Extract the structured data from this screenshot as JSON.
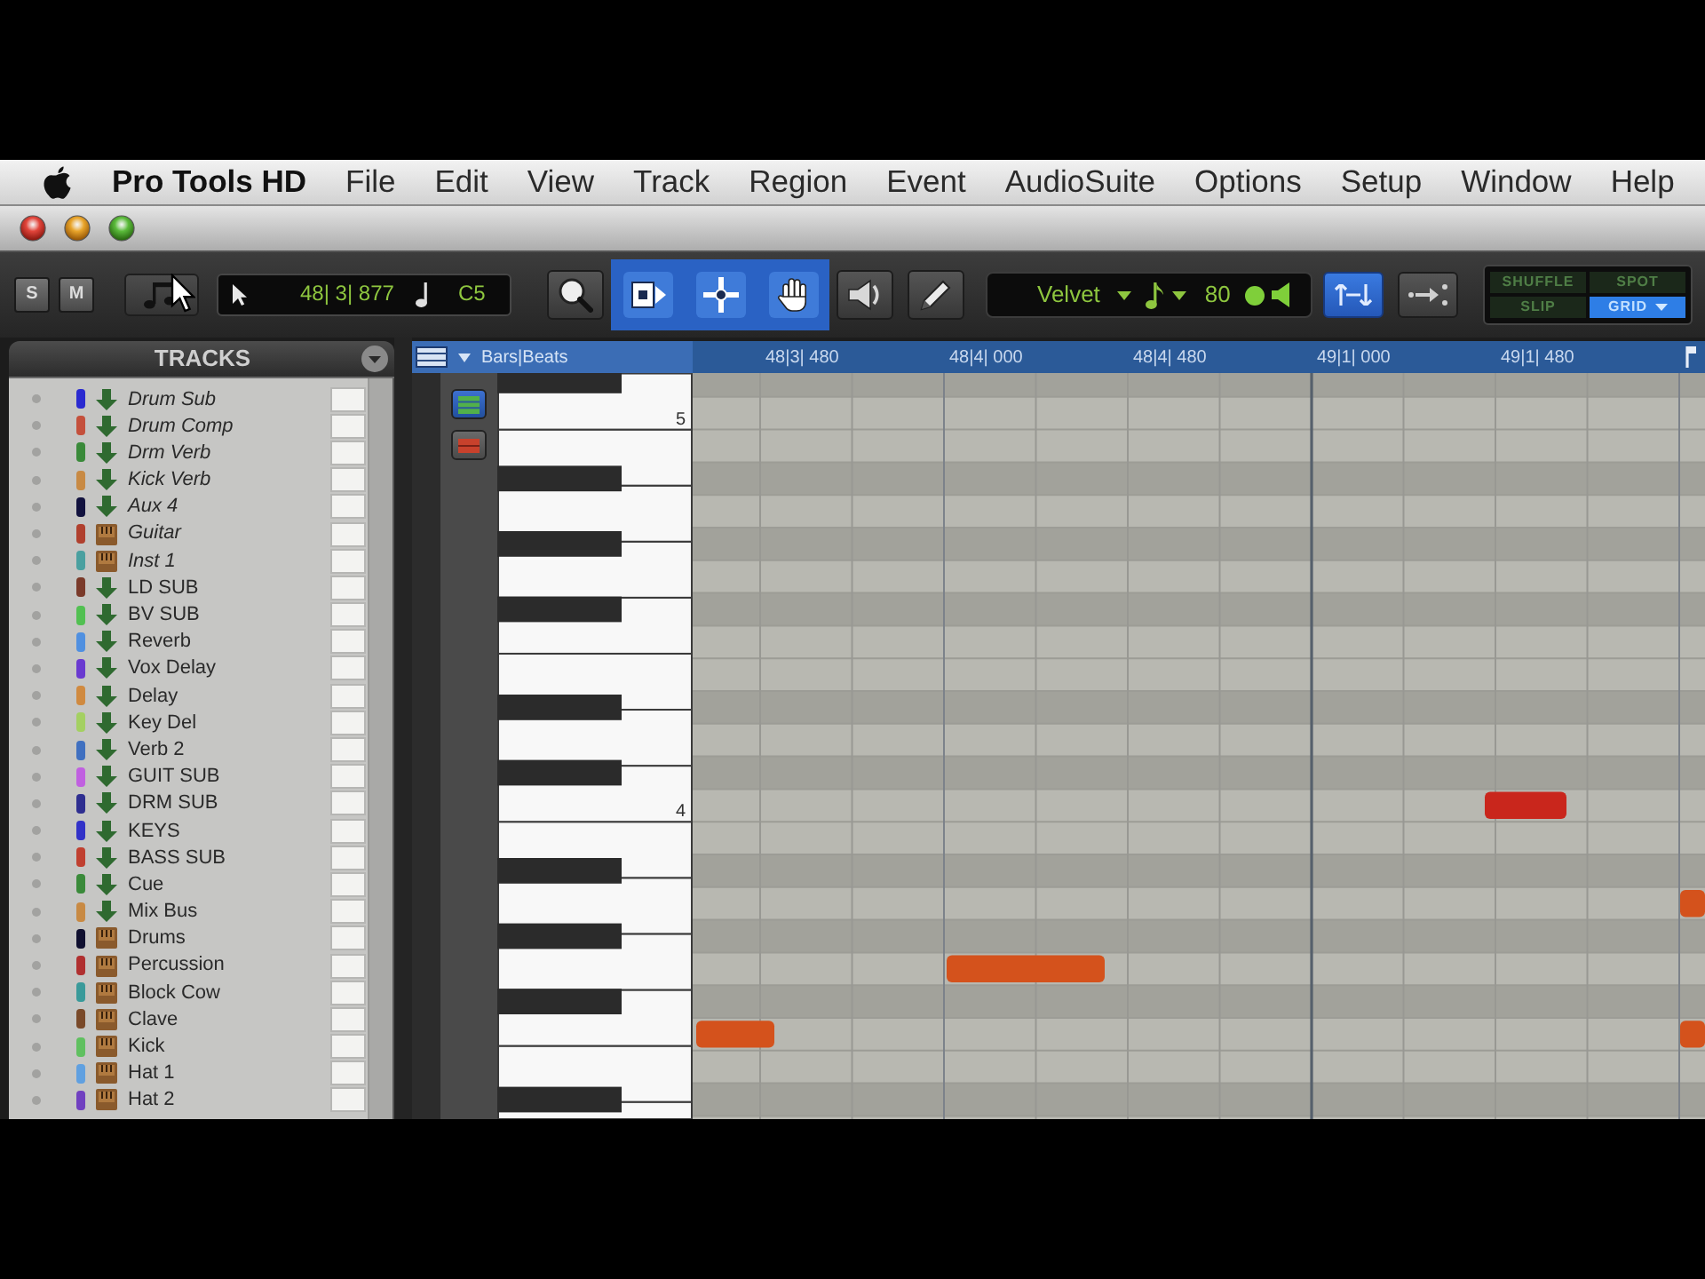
{
  "menu_bar": {
    "app_name": "Pro Tools HD",
    "items": [
      "File",
      "Edit",
      "View",
      "Track",
      "Region",
      "Event",
      "AudioSuite",
      "Options",
      "Setup",
      "Window",
      "Help"
    ]
  },
  "toolbar": {
    "solo": "S",
    "mute": "M",
    "counter": {
      "location": "48| 3| 877",
      "pitch": "C5"
    },
    "tools": [
      {
        "kind": "zoom",
        "selected": false
      },
      {
        "kind": "trim",
        "selected": true
      },
      {
        "kind": "selector",
        "selected": true
      },
      {
        "kind": "grabber",
        "selected": true
      },
      {
        "kind": "scrub",
        "selected": false
      },
      {
        "kind": "pencil",
        "selected": false
      }
    ],
    "midi_display": {
      "sound": "Velvet",
      "velocity": "80"
    },
    "toggles": [
      {
        "selected": true
      },
      {
        "selected": false
      }
    ],
    "edit_modes": [
      {
        "label": "SHUFFLE",
        "selected": false
      },
      {
        "label": "SPOT",
        "selected": false
      },
      {
        "label": "SLIP",
        "selected": false
      },
      {
        "label": "GRID",
        "selected": true
      }
    ]
  },
  "tracks_panel": {
    "title": "TRACKS",
    "tracks": [
      {
        "name": "Drum Sub",
        "kind": "aux",
        "color": "#2a2ad0",
        "inactive": true
      },
      {
        "name": "Drum Comp",
        "kind": "aux",
        "color": "#c4503c",
        "inactive": true
      },
      {
        "name": "Drm Verb",
        "kind": "aux",
        "color": "#3a8a3a",
        "inactive": true
      },
      {
        "name": "Kick Verb",
        "kind": "aux",
        "color": "#c88a44",
        "inactive": true
      },
      {
        "name": "Aux 4",
        "kind": "aux",
        "color": "#12123e",
        "inactive": true
      },
      {
        "name": "Guitar",
        "kind": "instrument",
        "color": "#b0402e",
        "inactive": true
      },
      {
        "name": "Inst 1",
        "kind": "instrument",
        "color": "#4aa0a0",
        "inactive": true
      },
      {
        "name": "LD SUB",
        "kind": "aux",
        "color": "#7a3a2a",
        "inactive": false
      },
      {
        "name": "BV SUB",
        "kind": "aux",
        "color": "#52c052",
        "inactive": false
      },
      {
        "name": "Reverb",
        "kind": "aux",
        "color": "#5090e0",
        "inactive": false
      },
      {
        "name": "Vox Delay",
        "kind": "aux",
        "color": "#6a3ad0",
        "inactive": false
      },
      {
        "name": "Delay",
        "kind": "aux",
        "color": "#d08a40",
        "inactive": false
      },
      {
        "name": "Key Del",
        "kind": "aux",
        "color": "#a4d062",
        "inactive": false
      },
      {
        "name": "Verb 2",
        "kind": "aux",
        "color": "#4070c0",
        "inactive": false
      },
      {
        "name": "GUIT SUB",
        "kind": "aux",
        "color": "#c060e0",
        "inactive": false
      },
      {
        "name": "DRM SUB",
        "kind": "aux",
        "color": "#2e2e90",
        "inactive": false
      },
      {
        "name": "KEYS",
        "kind": "aux",
        "color": "#3232c8",
        "inactive": false
      },
      {
        "name": "BASS SUB",
        "kind": "aux",
        "color": "#c04030",
        "inactive": false
      },
      {
        "name": "Cue",
        "kind": "aux",
        "color": "#3a8a3a",
        "inactive": false
      },
      {
        "name": "Mix Bus",
        "kind": "aux",
        "color": "#c88a44",
        "inactive": false
      },
      {
        "name": "Drums",
        "kind": "instrument",
        "color": "#101030",
        "inactive": false
      },
      {
        "name": "Percussion",
        "kind": "instrument",
        "color": "#b03030",
        "inactive": false
      },
      {
        "name": "Block Cow",
        "kind": "instrument",
        "color": "#3a9a9a",
        "inactive": false
      },
      {
        "name": "Clave",
        "kind": "instrument",
        "color": "#7a4a2a",
        "inactive": false
      },
      {
        "name": "Kick",
        "kind": "instrument",
        "color": "#60c060",
        "inactive": false
      },
      {
        "name": "Hat 1",
        "kind": "instrument",
        "color": "#60a0e0",
        "inactive": false
      },
      {
        "name": "Hat 2",
        "kind": "instrument",
        "color": "#7040c0",
        "inactive": false
      }
    ]
  },
  "ruler": {
    "title": "Bars|Beats",
    "ticks": [
      "48|3| 480",
      "48|4| 000",
      "48|4| 480",
      "49|1| 000",
      "49|1| 480"
    ]
  },
  "piano_roll": {
    "octave_labels": [
      "5",
      "4"
    ],
    "notes": [
      {
        "color": "#c9261c"
      },
      {
        "color": "#d4521c"
      },
      {
        "color": "#d4521c"
      },
      {
        "color": "#d4521c"
      },
      {
        "color": "#d4521c"
      }
    ]
  }
}
